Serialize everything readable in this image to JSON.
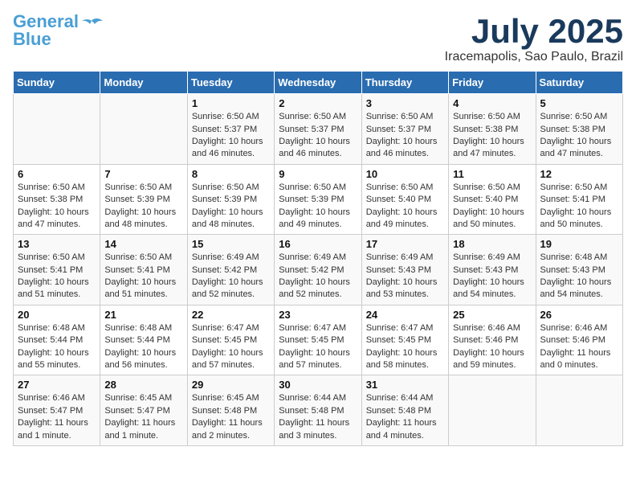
{
  "logo": {
    "line1": "General",
    "line2": "Blue"
  },
  "title": "July 2025",
  "subtitle": "Iracemapolis, Sao Paulo, Brazil",
  "days_of_week": [
    "Sunday",
    "Monday",
    "Tuesday",
    "Wednesday",
    "Thursday",
    "Friday",
    "Saturday"
  ],
  "weeks": [
    [
      {
        "day": "",
        "content": ""
      },
      {
        "day": "",
        "content": ""
      },
      {
        "day": "1",
        "content": "Sunrise: 6:50 AM\nSunset: 5:37 PM\nDaylight: 10 hours and 46 minutes."
      },
      {
        "day": "2",
        "content": "Sunrise: 6:50 AM\nSunset: 5:37 PM\nDaylight: 10 hours and 46 minutes."
      },
      {
        "day": "3",
        "content": "Sunrise: 6:50 AM\nSunset: 5:37 PM\nDaylight: 10 hours and 46 minutes."
      },
      {
        "day": "4",
        "content": "Sunrise: 6:50 AM\nSunset: 5:38 PM\nDaylight: 10 hours and 47 minutes."
      },
      {
        "day": "5",
        "content": "Sunrise: 6:50 AM\nSunset: 5:38 PM\nDaylight: 10 hours and 47 minutes."
      }
    ],
    [
      {
        "day": "6",
        "content": "Sunrise: 6:50 AM\nSunset: 5:38 PM\nDaylight: 10 hours and 47 minutes."
      },
      {
        "day": "7",
        "content": "Sunrise: 6:50 AM\nSunset: 5:39 PM\nDaylight: 10 hours and 48 minutes."
      },
      {
        "day": "8",
        "content": "Sunrise: 6:50 AM\nSunset: 5:39 PM\nDaylight: 10 hours and 48 minutes."
      },
      {
        "day": "9",
        "content": "Sunrise: 6:50 AM\nSunset: 5:39 PM\nDaylight: 10 hours and 49 minutes."
      },
      {
        "day": "10",
        "content": "Sunrise: 6:50 AM\nSunset: 5:40 PM\nDaylight: 10 hours and 49 minutes."
      },
      {
        "day": "11",
        "content": "Sunrise: 6:50 AM\nSunset: 5:40 PM\nDaylight: 10 hours and 50 minutes."
      },
      {
        "day": "12",
        "content": "Sunrise: 6:50 AM\nSunset: 5:41 PM\nDaylight: 10 hours and 50 minutes."
      }
    ],
    [
      {
        "day": "13",
        "content": "Sunrise: 6:50 AM\nSunset: 5:41 PM\nDaylight: 10 hours and 51 minutes."
      },
      {
        "day": "14",
        "content": "Sunrise: 6:50 AM\nSunset: 5:41 PM\nDaylight: 10 hours and 51 minutes."
      },
      {
        "day": "15",
        "content": "Sunrise: 6:49 AM\nSunset: 5:42 PM\nDaylight: 10 hours and 52 minutes."
      },
      {
        "day": "16",
        "content": "Sunrise: 6:49 AM\nSunset: 5:42 PM\nDaylight: 10 hours and 52 minutes."
      },
      {
        "day": "17",
        "content": "Sunrise: 6:49 AM\nSunset: 5:43 PM\nDaylight: 10 hours and 53 minutes."
      },
      {
        "day": "18",
        "content": "Sunrise: 6:49 AM\nSunset: 5:43 PM\nDaylight: 10 hours and 54 minutes."
      },
      {
        "day": "19",
        "content": "Sunrise: 6:48 AM\nSunset: 5:43 PM\nDaylight: 10 hours and 54 minutes."
      }
    ],
    [
      {
        "day": "20",
        "content": "Sunrise: 6:48 AM\nSunset: 5:44 PM\nDaylight: 10 hours and 55 minutes."
      },
      {
        "day": "21",
        "content": "Sunrise: 6:48 AM\nSunset: 5:44 PM\nDaylight: 10 hours and 56 minutes."
      },
      {
        "day": "22",
        "content": "Sunrise: 6:47 AM\nSunset: 5:45 PM\nDaylight: 10 hours and 57 minutes."
      },
      {
        "day": "23",
        "content": "Sunrise: 6:47 AM\nSunset: 5:45 PM\nDaylight: 10 hours and 57 minutes."
      },
      {
        "day": "24",
        "content": "Sunrise: 6:47 AM\nSunset: 5:45 PM\nDaylight: 10 hours and 58 minutes."
      },
      {
        "day": "25",
        "content": "Sunrise: 6:46 AM\nSunset: 5:46 PM\nDaylight: 10 hours and 59 minutes."
      },
      {
        "day": "26",
        "content": "Sunrise: 6:46 AM\nSunset: 5:46 PM\nDaylight: 11 hours and 0 minutes."
      }
    ],
    [
      {
        "day": "27",
        "content": "Sunrise: 6:46 AM\nSunset: 5:47 PM\nDaylight: 11 hours and 1 minute."
      },
      {
        "day": "28",
        "content": "Sunrise: 6:45 AM\nSunset: 5:47 PM\nDaylight: 11 hours and 1 minute."
      },
      {
        "day": "29",
        "content": "Sunrise: 6:45 AM\nSunset: 5:48 PM\nDaylight: 11 hours and 2 minutes."
      },
      {
        "day": "30",
        "content": "Sunrise: 6:44 AM\nSunset: 5:48 PM\nDaylight: 11 hours and 3 minutes."
      },
      {
        "day": "31",
        "content": "Sunrise: 6:44 AM\nSunset: 5:48 PM\nDaylight: 11 hours and 4 minutes."
      },
      {
        "day": "",
        "content": ""
      },
      {
        "day": "",
        "content": ""
      }
    ]
  ]
}
